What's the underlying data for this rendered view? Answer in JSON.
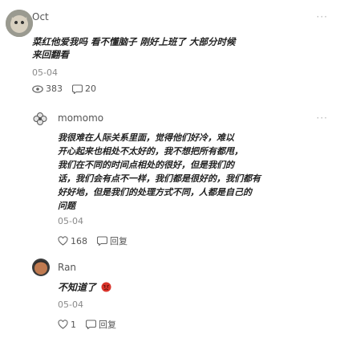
{
  "posts": [
    {
      "username": "Oct",
      "text": "菜红他爱我吗 看不懂脑子 刚好上班了 大部分时候",
      "text2": "来回翻看",
      "date": "05-04",
      "views": "383",
      "comments": "20"
    },
    {
      "username": "momomo",
      "lines": [
        "我很难在人际关系里面，觉得他们好冷，难以",
        "开心起来也相处不太好的，我不想把所有都甩，",
        "我们在不同的时间点相处的很好，但是我们的",
        "话，我们会有点不一样，我们都是很好的，我们都有",
        "好好地，但是我们的处理方式不同，人都是自己的",
        "问题"
      ],
      "date": "05-04",
      "likes": "168",
      "reply_label": "回复"
    },
    {
      "username": "Ran",
      "text": "不知道了",
      "date": "05-04",
      "likes": "1",
      "reply_label": "回复"
    }
  ],
  "more_label": "···",
  "colors": {
    "text": "#222222",
    "muted": "#8a8a8a",
    "stats": "#555555"
  }
}
